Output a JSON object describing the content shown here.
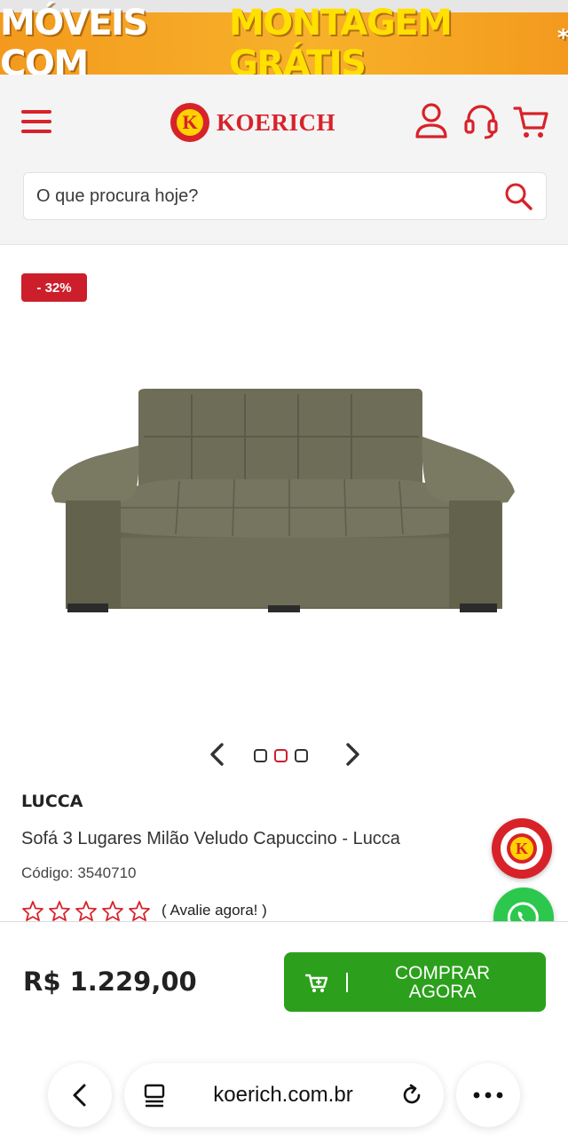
{
  "promo": {
    "part1": "MÓVEIS COM",
    "part2": "MONTAGEM GRÁTIS",
    "asterisk": "*"
  },
  "header": {
    "logo_letter": "K",
    "logo_text": "KOERICH",
    "icons": [
      "menu-icon",
      "user-icon",
      "headset-icon",
      "cart-icon"
    ]
  },
  "search": {
    "placeholder": "O que procura hoje?",
    "value": "",
    "icon": "search-icon"
  },
  "product": {
    "discount": "- 32%",
    "brand": "LUCCA",
    "title": "Sofá 3 Lugares Milão Veludo Capuccino - Lucca",
    "code": "Código: 3540710",
    "rating_stars": 0,
    "rating_max": 5,
    "rate_link": "( Avalie agora! )",
    "carousel": {
      "total": 3,
      "active": 2
    }
  },
  "floating": {
    "koerich_letter": "K",
    "whatsapp_icon": "whatsapp-icon"
  },
  "buy": {
    "price": "R$ 1.229,00",
    "button": "COMPRAR\nAGORA"
  },
  "browser": {
    "url": "koerich.com.br"
  },
  "colors": {
    "brand_red": "#d8222a",
    "badge_red": "#cc1f2b",
    "buy_green": "#2ca01c",
    "whatsapp_green": "#2bc84d",
    "promo_orange": "#f39a1e",
    "promo_yellow": "#ffe000"
  }
}
